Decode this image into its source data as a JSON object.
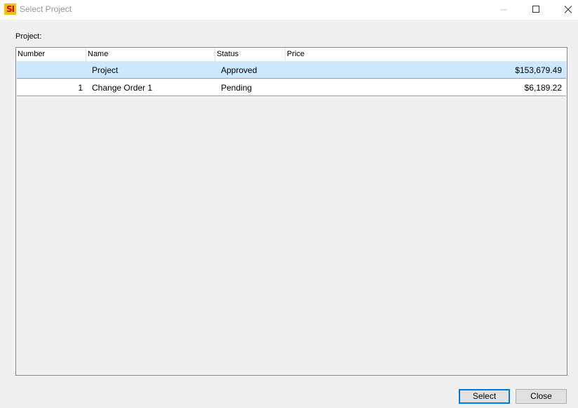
{
  "window": {
    "title": "Select Project",
    "icon_text": "SI",
    "icon_colors": {
      "background": "#f2c200",
      "text": "#d10000"
    }
  },
  "form": {
    "project_label": "Project:"
  },
  "table": {
    "columns": [
      "Number",
      "Name",
      "Status",
      "Price"
    ],
    "rows": [
      {
        "number": "",
        "name": "Project",
        "status": "Approved",
        "price": "$153,679.49",
        "selected": true
      },
      {
        "number": "1",
        "name": "Change Order 1",
        "status": "Pending",
        "price": "$6,189.22",
        "selected": false
      }
    ],
    "selection_color": "#cce8ff"
  },
  "buttons": {
    "select_label": "Select",
    "close_label": "Close"
  },
  "icons": {
    "minimize": "minimize-icon",
    "maximize": "maximize-icon",
    "close": "close-icon"
  }
}
